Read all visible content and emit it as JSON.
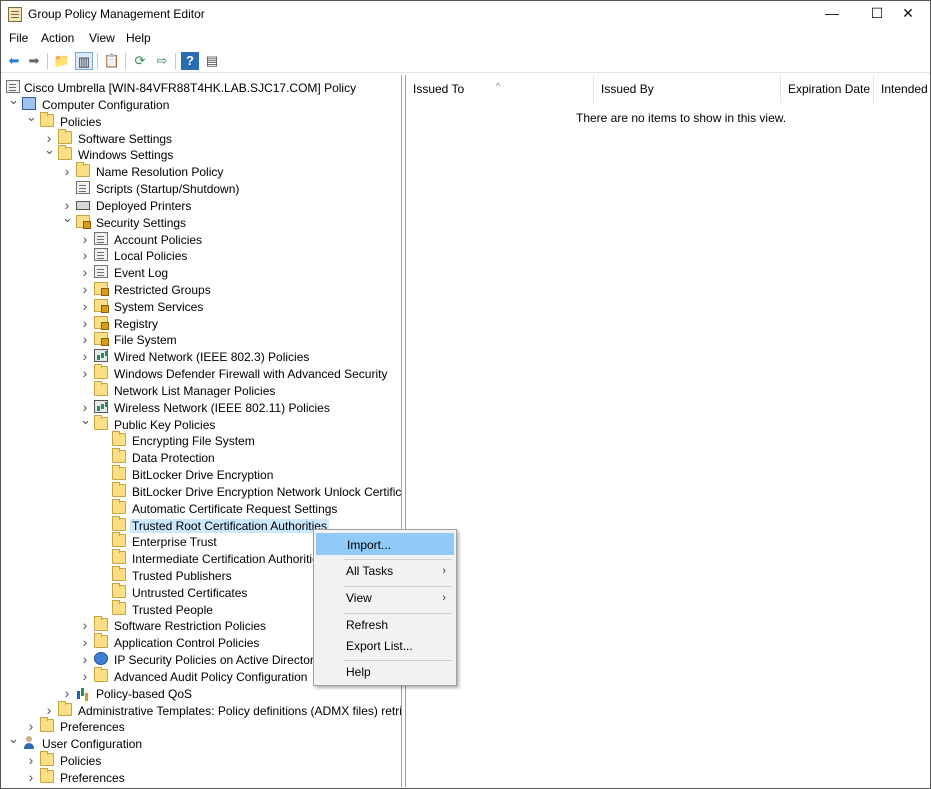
{
  "window": {
    "title": "Group Policy Management Editor",
    "minimize": "—",
    "maximize": "☐",
    "close": "✕"
  },
  "menu": [
    "File",
    "Action",
    "View",
    "Help"
  ],
  "tree": {
    "root": "Cisco Umbrella [WIN-84VFR88T4HK.LAB.SJC17.COM] Policy",
    "items": [
      {
        "label": "Computer Configuration",
        "icon": "computer-icon"
      },
      {
        "label": "Policies",
        "icon": "folder-icon"
      },
      {
        "label": "Software Settings",
        "icon": "folder-icon"
      },
      {
        "label": "Windows Settings",
        "icon": "folder-icon"
      },
      {
        "label": "Name Resolution Policy",
        "icon": "folder-icon"
      },
      {
        "label": "Scripts (Startup/Shutdown)",
        "icon": "document-icon"
      },
      {
        "label": "Deployed Printers",
        "icon": "printer-icon"
      },
      {
        "label": "Security Settings",
        "icon": "security-icon"
      },
      {
        "label": "Account Policies",
        "icon": "document-icon"
      },
      {
        "label": "Local Policies",
        "icon": "document-icon"
      },
      {
        "label": "Event Log",
        "icon": "document-icon"
      },
      {
        "label": "Restricted Groups",
        "icon": "locked-folder-icon"
      },
      {
        "label": "System Services",
        "icon": "locked-folder-icon"
      },
      {
        "label": "Registry",
        "icon": "locked-folder-icon"
      },
      {
        "label": "File System",
        "icon": "locked-folder-icon"
      },
      {
        "label": "Wired Network (IEEE 802.3) Policies",
        "icon": "network-icon"
      },
      {
        "label": "Windows Defender Firewall with Advanced Security",
        "icon": "folder-icon"
      },
      {
        "label": "Network List Manager Policies",
        "icon": "folder-icon"
      },
      {
        "label": "Wireless Network (IEEE 802.11) Policies",
        "icon": "network-icon"
      },
      {
        "label": "Public Key Policies",
        "icon": "folder-icon"
      },
      {
        "label": "Encrypting File System",
        "icon": "folder-icon"
      },
      {
        "label": "Data Protection",
        "icon": "folder-icon"
      },
      {
        "label": "BitLocker Drive Encryption",
        "icon": "folder-icon"
      },
      {
        "label": "BitLocker Drive Encryption Network Unlock Certificate",
        "icon": "folder-icon"
      },
      {
        "label": "Automatic Certificate Request Settings",
        "icon": "folder-icon"
      },
      {
        "label": "Trusted Root Certification Authorities",
        "icon": "folder-icon"
      },
      {
        "label": "Enterprise Trust",
        "icon": "folder-icon"
      },
      {
        "label": "Intermediate Certification Authorities",
        "icon": "folder-icon"
      },
      {
        "label": "Trusted Publishers",
        "icon": "folder-icon"
      },
      {
        "label": "Untrusted Certificates",
        "icon": "folder-icon"
      },
      {
        "label": "Trusted People",
        "icon": "folder-icon"
      },
      {
        "label": "Software Restriction Policies",
        "icon": "folder-icon"
      },
      {
        "label": "Application Control Policies",
        "icon": "folder-icon"
      },
      {
        "label": "IP Security Policies on Active Directory (L",
        "icon": "shield-icon"
      },
      {
        "label": "Advanced Audit Policy Configuration",
        "icon": "folder-icon"
      },
      {
        "label": "Policy-based QoS",
        "icon": "bar-chart-icon"
      },
      {
        "label": "Administrative Templates: Policy definitions (ADMX files) retrieved",
        "icon": "folder-icon"
      },
      {
        "label": "Preferences",
        "icon": "folder-icon"
      },
      {
        "label": "User Configuration",
        "icon": "user-icon"
      },
      {
        "label": "Policies",
        "icon": "folder-icon"
      },
      {
        "label": "Preferences",
        "icon": "folder-icon"
      }
    ]
  },
  "list": {
    "columns": [
      "Issued To",
      "Issued By",
      "Expiration Date",
      "Intended P"
    ],
    "empty_message": "There are no items to show in this view."
  },
  "context_menu": {
    "items": [
      "Import...",
      "All Tasks",
      "View",
      "Refresh",
      "Export List...",
      "Help"
    ]
  }
}
